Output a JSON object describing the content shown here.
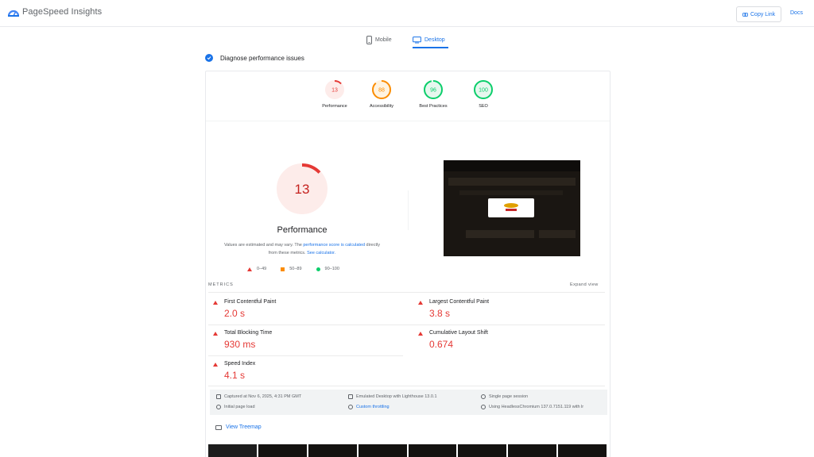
{
  "header": {
    "app_name": "PageSpeed Insights",
    "copy_link_label": "Copy Link",
    "docs_label": "Docs"
  },
  "tabs": [
    {
      "label": "Mobile",
      "icon": "phone-icon",
      "selected": false
    },
    {
      "label": "Desktop",
      "icon": "monitor-icon",
      "selected": true
    }
  ],
  "diagnose_label": "Diagnose performance issues",
  "categories": [
    {
      "label": "Performance",
      "score": "13",
      "score_value": 13,
      "color": "#e53935",
      "bg": "#fdecea"
    },
    {
      "label": "Accessibility",
      "score": "88",
      "score_value": 88,
      "color": "#fb8c00",
      "bg": "#fff3e0"
    },
    {
      "label": "Best Practices",
      "score": "96",
      "score_value": 96,
      "color": "#0cce6b",
      "bg": "#e6f7ee"
    },
    {
      "label": "SEO",
      "score": "100",
      "score_value": 100,
      "color": "#0cce6b",
      "bg": "#e6f7ee"
    }
  ],
  "performance": {
    "score": "13",
    "score_value": 13,
    "title": "Performance",
    "note_before": "Values are estimated and may vary. The ",
    "note_link1": "performance score is calculated",
    "note_middle": " directly from these metrics. ",
    "note_link2": "See calculator.",
    "legend": [
      "0–49",
      "50–89",
      "90–100"
    ]
  },
  "metrics": {
    "title": "METRICS",
    "expand_label": "Expand view",
    "items": [
      {
        "name": "First Contentful Paint",
        "value": "2.0 s"
      },
      {
        "name": "Largest Contentful Paint",
        "value": "3.8 s"
      },
      {
        "name": "Total Blocking Time",
        "value": "930 ms"
      },
      {
        "name": "Cumulative Layout Shift",
        "value": "0.674"
      },
      {
        "name": "Speed Index",
        "value": "4.1 s"
      }
    ]
  },
  "info": {
    "captured": "Captured at Nov 6, 2025, 4:31 PM GMT",
    "emulated": "Emulated Desktop with Lighthouse 13.0.1",
    "session": "Single page session",
    "initial_load": "Initial page load",
    "throttling": "Custom throttling",
    "browser": "Using HeadlessChromium 137.0.7151.119 with lr"
  },
  "treemap_label": "View Treemap",
  "colors": {
    "accent": "#1a73e8",
    "fail": "#e53935",
    "average": "#fb8c00",
    "pass": "#0cce6b"
  }
}
